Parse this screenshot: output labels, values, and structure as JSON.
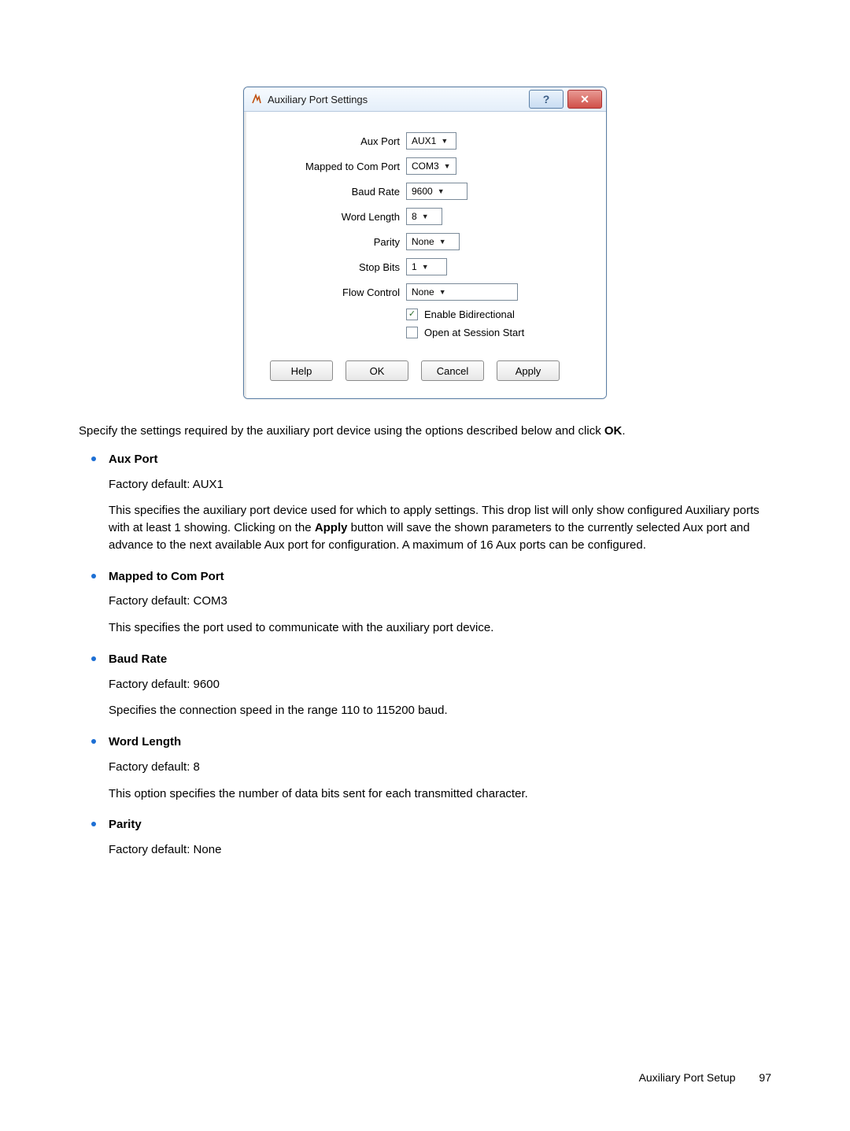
{
  "dialog": {
    "title": "Auxiliary Port Settings",
    "fields": {
      "aux_port": {
        "label": "Aux Port",
        "value": "AUX1"
      },
      "com_port": {
        "label": "Mapped to Com Port",
        "value": "COM3"
      },
      "baud_rate": {
        "label": "Baud Rate",
        "value": "9600"
      },
      "word_len": {
        "label": "Word Length",
        "value": "8"
      },
      "parity": {
        "label": "Parity",
        "value": "None"
      },
      "stop_bits": {
        "label": "Stop Bits",
        "value": "1"
      },
      "flow_ctrl": {
        "label": "Flow Control",
        "value": "None"
      }
    },
    "checks": {
      "bidir": {
        "label": "Enable Bidirectional",
        "checked": true
      },
      "open_start": {
        "label": "Open at Session Start",
        "checked": false
      }
    },
    "buttons": {
      "help": "Help",
      "ok": "OK",
      "cancel": "Cancel",
      "apply": "Apply"
    }
  },
  "doc": {
    "intro_pre": "Specify the settings required by the auxiliary port device using the options described below and click ",
    "intro_bold": "OK",
    "intro_post": ".",
    "items": [
      {
        "term": "Aux Port",
        "paras": [
          "Factory default: AUX1",
          "This specifies the auxiliary port device used for which to apply settings. This drop list will only show configured Auxiliary ports with at least 1 showing. Clicking on the Apply button will save the shown parameters to the currently selected Aux port and advance to the next available Aux port for configuration. A maximum of 16 Aux ports can be configured."
        ],
        "bold_in_para": "Apply"
      },
      {
        "term": "Mapped to Com Port",
        "paras": [
          "Factory default: COM3",
          "This specifies the port used to communicate with the auxiliary port device."
        ]
      },
      {
        "term": "Baud Rate",
        "paras": [
          "Factory default: 9600",
          "Specifies the connection speed in the range 110 to 115200 baud."
        ]
      },
      {
        "term": "Word Length",
        "paras": [
          "Factory default: 8",
          "This option specifies the number of data bits sent for each transmitted character."
        ]
      },
      {
        "term": "Parity",
        "paras": [
          "Factory default: None"
        ]
      }
    ]
  },
  "footer": {
    "section": "Auxiliary Port Setup",
    "page": "97"
  }
}
